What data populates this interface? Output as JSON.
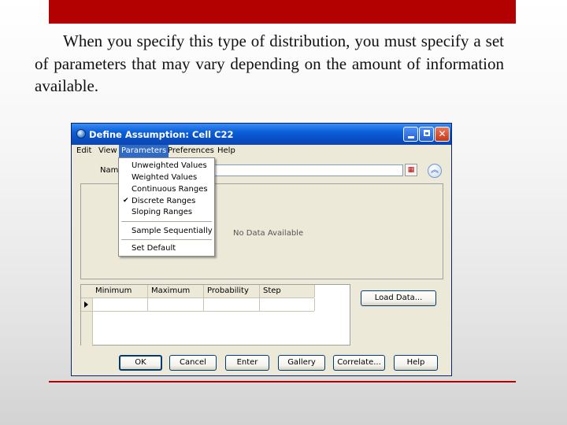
{
  "slide": {
    "paragraph": "When you specify this type of distribution, you must specify a set of parameters that may vary depending on the amount of information available."
  },
  "dialog": {
    "title": "Define Assumption: Cell C22",
    "menu": [
      "Edit",
      "View",
      "Parameters",
      "Preferences",
      "Help"
    ],
    "active_menu": "Parameters",
    "name_label": "Name",
    "name_value": "",
    "chart_placeholder": "No Data Available",
    "parameters_menu": {
      "items": [
        "Unweighted Values",
        "Weighted Values",
        "Continuous Ranges",
        "Discrete Ranges",
        "Sloping Ranges"
      ],
      "checked": "Discrete Ranges",
      "item_sample": "Sample Sequentially",
      "item_default": "Set Default"
    },
    "grid": {
      "columns": [
        "Minimum",
        "Maximum",
        "Probability",
        "Step"
      ]
    },
    "load_data": "Load Data...",
    "buttons": [
      "OK",
      "Cancel",
      "Enter",
      "Gallery",
      "Correlate...",
      "Help"
    ]
  },
  "colors": {
    "accent_bar": "#b30000",
    "titlebar": "#0a5fd8",
    "dialog_bg": "#ece9d8"
  },
  "icons": [
    "close-icon",
    "maximize-icon",
    "minimize-icon",
    "cell-select-icon",
    "collapse-icon",
    "check-icon",
    "row-pointer-icon"
  ]
}
